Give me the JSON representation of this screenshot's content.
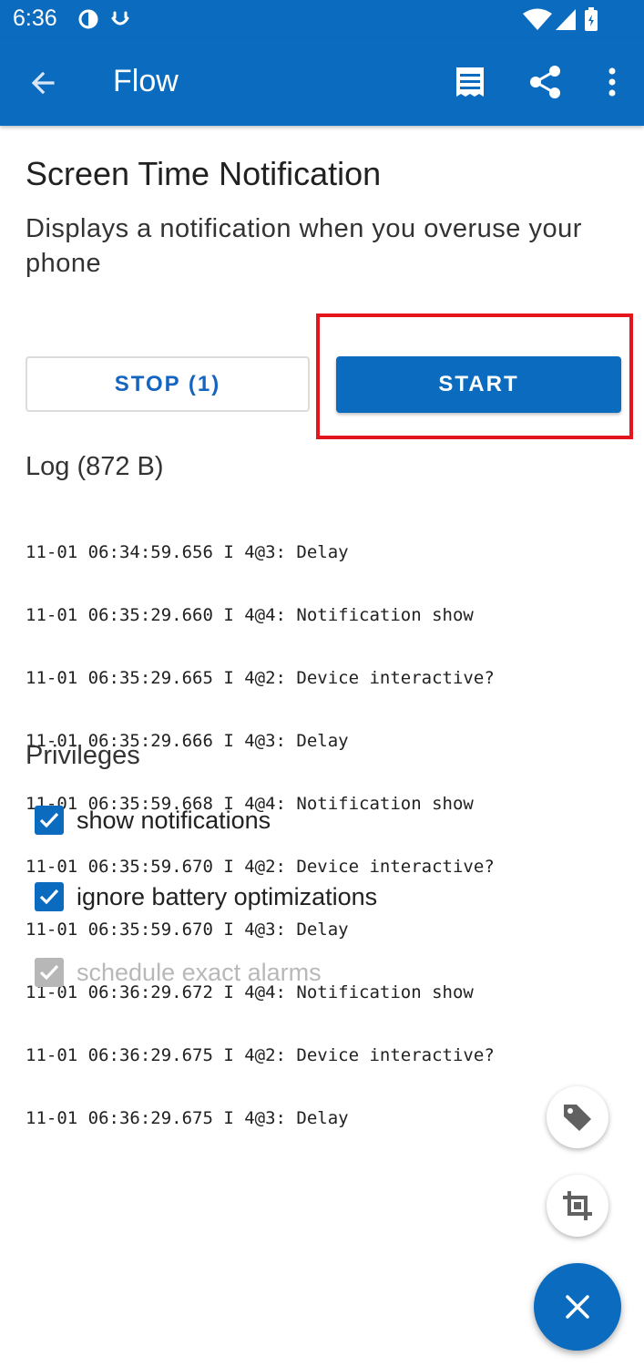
{
  "status_bar": {
    "time": "6:36",
    "icons": [
      "data-saver-icon",
      "face-icon",
      "wifi-icon",
      "signal-icon",
      "battery-icon"
    ]
  },
  "app_bar": {
    "title": "Flow",
    "icons": [
      "back-arrow-icon",
      "log-icon",
      "share-icon",
      "more-vert-icon"
    ]
  },
  "flow": {
    "title": "Screen Time Notification",
    "description": "Displays a notification when you overuse your phone"
  },
  "buttons": {
    "stop_label": "STOP (1)",
    "start_label": "START"
  },
  "log": {
    "title": "Log (872 B)",
    "lines": [
      "11-01 06:34:59.656 I 4@3: Delay",
      "11-01 06:35:29.660 I 4@4: Notification show",
      "11-01 06:35:29.665 I 4@2: Device interactive?",
      "11-01 06:35:29.666 I 4@3: Delay",
      "11-01 06:35:59.668 I 4@4: Notification show",
      "11-01 06:35:59.670 I 4@2: Device interactive?",
      "11-01 06:35:59.670 I 4@3: Delay",
      "11-01 06:36:29.672 I 4@4: Notification show",
      "11-01 06:36:29.675 I 4@2: Device interactive?",
      "11-01 06:36:29.675 I 4@3: Delay"
    ]
  },
  "privileges": {
    "title": "Privileges",
    "items": [
      {
        "label": "show notifications",
        "checked": true,
        "enabled": true
      },
      {
        "label": "ignore battery optimizations",
        "checked": true,
        "enabled": true
      },
      {
        "label": "schedule exact alarms",
        "checked": true,
        "enabled": false
      }
    ]
  },
  "fabs": [
    "tag-icon",
    "crop-icon",
    "close-icon"
  ],
  "colors": {
    "primary": "#0b6bbf",
    "highlight": "#e4161b"
  }
}
